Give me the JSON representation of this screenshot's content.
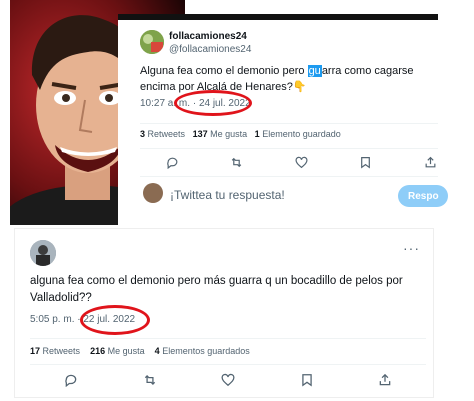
{
  "top_tweet": {
    "display_name": "follacamiones24",
    "handle": "@follacamiones24",
    "text_before": "Alguna fea como el demonio pero ",
    "text_highlight": "gu",
    "text_after": "arra como cagarse encima por Alcalá de Henares?",
    "emoji": "👇",
    "time": "10:27 a. m.",
    "separator": "·",
    "date": "24 jul. 2022",
    "retweets_count": "3",
    "retweets_label": "Retweets",
    "likes_count": "137",
    "likes_label": "Me gusta",
    "saved_count": "1",
    "saved_label": "Elemento guardado",
    "reply_placeholder": "¡Twittea tu respuesta!",
    "reply_button": "Respo"
  },
  "bottom_tweet": {
    "more": "···",
    "text": "alguna fea como el demonio pero más guarra q un bocadillo de pelos por Valladolid??",
    "time": "5:05 p. m.",
    "separator": "·",
    "date": "22 jul. 2022",
    "retweets_count": "17",
    "retweets_label": "Retweets",
    "likes_count": "216",
    "likes_label": "Me gusta",
    "saved_count": "4",
    "saved_label": "Elementos guardados"
  },
  "icons": [
    "reply-icon",
    "retweet-icon",
    "like-icon",
    "bookmark-icon",
    "share-icon"
  ],
  "colors": {
    "highlight": "#1d9bf0",
    "circle": "#e0141b",
    "muted": "#536471"
  }
}
